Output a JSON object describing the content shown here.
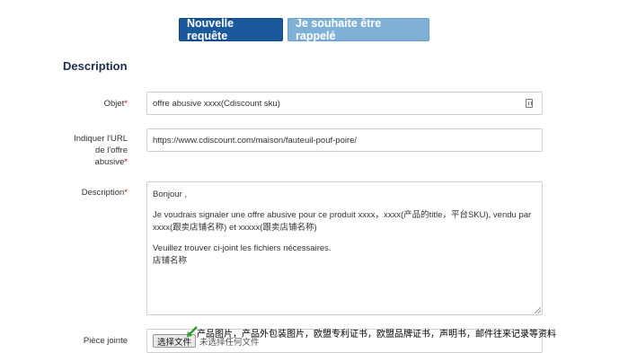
{
  "actions": {
    "new_request": "Nouvelle requête",
    "callback": "Je souhaite être rappelé"
  },
  "section_title": "Description",
  "form": {
    "required_marker": "*",
    "subject": {
      "label": "Objet",
      "value": "offre abusive xxxx(Cdiscount sku)"
    },
    "url": {
      "label_lines": [
        "Indiquer l'URL",
        "de l'offre",
        "abusive"
      ],
      "value": "https://www.cdiscount.com/maison/fauteuil-pouf-poire/"
    },
    "description": {
      "label": "Description",
      "lines": [
        "Bonjour ,",
        "Je voudrais signaler une offre abusive pour ce produit xxxx，xxxx(产品的title，平台SKU), vendu par",
        "xxxx(跟卖店铺名称) et xxxxx(跟卖店铺名称)",
        "Veuillez trouver ci-joint les fichiers nécessaires.",
        "店铺名称"
      ]
    },
    "attachment": {
      "label": "Pièce jointe",
      "button_label": "选择文件",
      "status": "未选择任何文件"
    }
  },
  "annotation": "产品图片，产品外包装图片，欧盟专利证书，欧盟品牌证书，声明书，邮件往来记录等资料"
}
